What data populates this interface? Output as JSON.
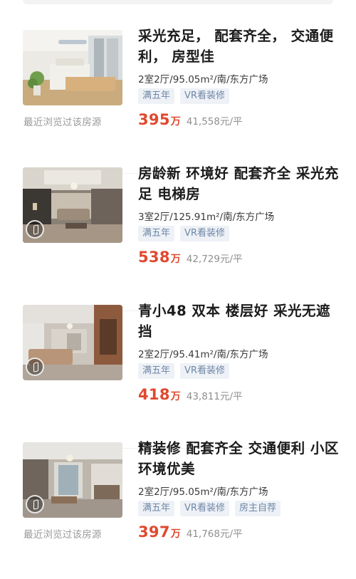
{
  "recent_note_label": "最近浏览过该房源",
  "price_unit": "万",
  "colors": {
    "price": "#e0492e",
    "tag_text": "#6f86a6",
    "tag_bg": "#eef2f7"
  },
  "listings": [
    {
      "title": "采光充足， 配套齐全， 交通便利， 房型佳",
      "spec": "2室2厅/95.05m²/南/东方广场",
      "tags": [
        "满五年",
        "VR看装修"
      ],
      "price": "395",
      "unit_price": "41,558元/平",
      "recently_viewed": true,
      "vr_icon": false
    },
    {
      "title": "房龄新 环境好 配套齐全 采光充足 电梯房",
      "spec": "3室2厅/125.91m²/南/东方广场",
      "tags": [
        "满五年",
        "VR看装修"
      ],
      "price": "538",
      "unit_price": "42,729元/平",
      "recently_viewed": false,
      "vr_icon": true
    },
    {
      "title": "青小48 双本 楼层好 采光无遮挡",
      "spec": "2室2厅/95.41m²/南/东方广场",
      "tags": [
        "满五年",
        "VR看装修"
      ],
      "price": "418",
      "unit_price": "43,811元/平",
      "recently_viewed": false,
      "vr_icon": true
    },
    {
      "title": "精装修 配套齐全 交通便利 小区环境优美",
      "spec": "2室2厅/95.05m²/南/东方广场",
      "tags": [
        "满五年",
        "VR看装修",
        "房主自荐"
      ],
      "price": "397",
      "unit_price": "41,768元/平",
      "recently_viewed": true,
      "vr_icon": true
    }
  ]
}
